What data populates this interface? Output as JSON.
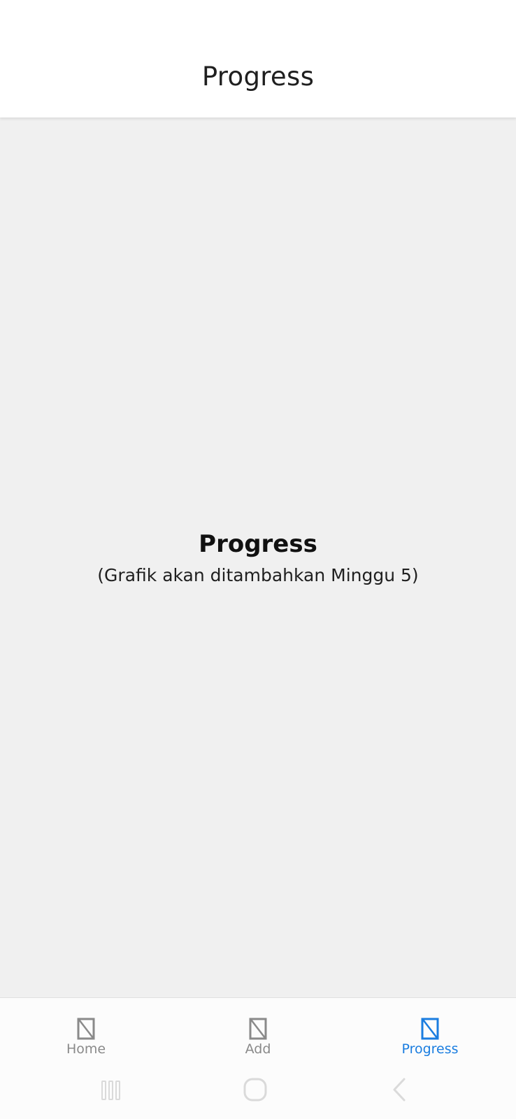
{
  "header": {
    "title": "Progress"
  },
  "main": {
    "title": "Progress",
    "subtitle": "(Grafik akan ditambahkan Minggu 5)"
  },
  "bottom_nav": {
    "items": [
      {
        "label": "Home",
        "icon": "placeholder-icon",
        "active": false
      },
      {
        "label": "Add",
        "icon": "placeholder-icon",
        "active": false
      },
      {
        "label": "Progress",
        "icon": "placeholder-icon",
        "active": true
      }
    ],
    "active_color": "#1a7de0",
    "inactive_color": "#8a8a8a"
  },
  "system_nav": {
    "buttons": [
      "recent-apps-icon",
      "home-icon",
      "back-icon"
    ]
  }
}
